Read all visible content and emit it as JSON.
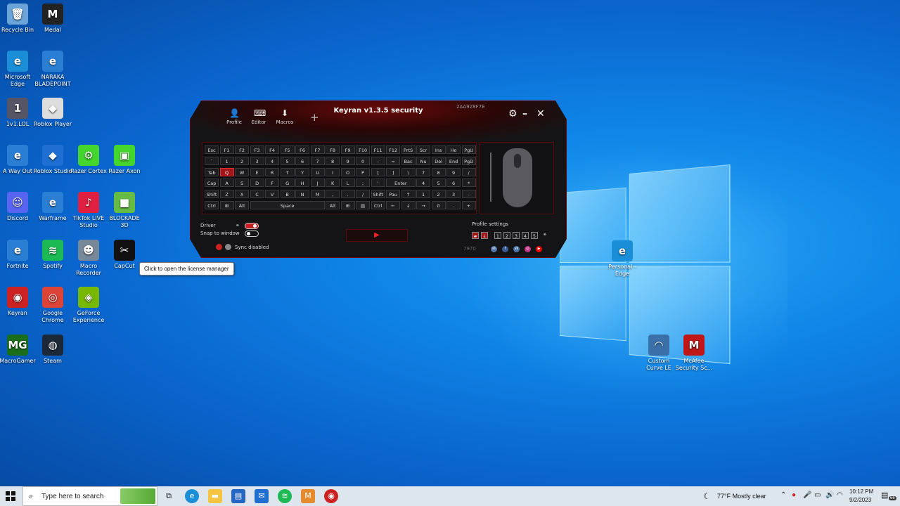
{
  "desktop": {
    "icons": [
      {
        "label": "Recycle Bin",
        "glyph": "🗑",
        "color": "#6aa4d8"
      },
      {
        "label": "Medal",
        "glyph": "M",
        "color": "#222"
      },
      {
        "label": "Microsoft Edge",
        "glyph": "e",
        "color": "#1b8ed8"
      },
      {
        "label": "NARAKA BLADEPOINT",
        "glyph": "e",
        "color": "#2a7fd4"
      },
      {
        "label": "1v1.LOL",
        "glyph": "1",
        "color": "#556"
      },
      {
        "label": "Roblox Player",
        "glyph": "◆",
        "color": "#ddd"
      },
      {
        "label": "A Way Out",
        "glyph": "e",
        "color": "#2a7fd4"
      },
      {
        "label": "Roblox Studio",
        "glyph": "◆",
        "color": "#1e6fd1"
      },
      {
        "label": "Razer Cortex",
        "glyph": "⚙",
        "color": "#44d62c"
      },
      {
        "label": "Razer Axon",
        "glyph": "▣",
        "color": "#44d62c"
      },
      {
        "label": "Discord",
        "glyph": "☺",
        "color": "#5865f2"
      },
      {
        "label": "Warframe",
        "glyph": "e",
        "color": "#2a7fd4"
      },
      {
        "label": "TikTok LIVE Studio",
        "glyph": "♪",
        "color": "#e02040"
      },
      {
        "label": "BLOCKADE 3D",
        "glyph": "■",
        "color": "#6b4"
      },
      {
        "label": "Fortnite",
        "glyph": "e",
        "color": "#2a7fd4"
      },
      {
        "label": "Spotify",
        "glyph": "≋",
        "color": "#1db954"
      },
      {
        "label": "Macro Recorder",
        "glyph": "☻",
        "color": "#789"
      },
      {
        "label": "CapCut",
        "glyph": "✂",
        "color": "#111"
      },
      {
        "label": "Keyran",
        "glyph": "◉",
        "color": "#c22"
      },
      {
        "label": "Google Chrome",
        "glyph": "◎",
        "color": "#db4437"
      },
      {
        "label": "GeForce Experience",
        "glyph": "◈",
        "color": "#76b900"
      },
      {
        "label": "MacroGamer",
        "glyph": "MG",
        "color": "#1a6e1a"
      },
      {
        "label": "Steam",
        "glyph": "◍",
        "color": "#1b2838"
      },
      {
        "label": "Personal - Edge",
        "glyph": "e",
        "color": "#1b8ed8"
      },
      {
        "label": "Custom Curve LE",
        "glyph": "◠",
        "color": "#3a6fa8"
      },
      {
        "label": "McAfee Security Sc...",
        "glyph": "M",
        "color": "#c01818"
      }
    ],
    "tooltip": "Click to open the license manager"
  },
  "keyran": {
    "title": "Keyran v1.3.5 security",
    "id_code": "2AA928F7E",
    "toolbar": [
      {
        "label": "Profile",
        "icon": "user-icon"
      },
      {
        "label": "Editor",
        "icon": "keyboard-icon"
      },
      {
        "label": "Macros",
        "icon": "download-icon"
      }
    ],
    "keyboard_rows": [
      [
        "Esc",
        "F1",
        "F2",
        "F3",
        "F4",
        "F5",
        "F6",
        "F7",
        "F8",
        "F9",
        "F10",
        "F11",
        "F12",
        "PrtS",
        "Scr",
        "Ins",
        "Ho",
        "PgU"
      ],
      [
        "`",
        "1",
        "2",
        "3",
        "4",
        "5",
        "6",
        "7",
        "8",
        "9",
        "0",
        "-",
        "=",
        "Bac",
        "Nu",
        "Del",
        "End",
        "PgD"
      ],
      [
        "Tab",
        "Q",
        "W",
        "E",
        "R",
        "T",
        "Y",
        "U",
        "I",
        "O",
        "P",
        "[",
        "]",
        "\\",
        "7",
        "8",
        "9",
        "/"
      ],
      [
        "Cap",
        "A",
        "S",
        "D",
        "F",
        "G",
        "H",
        "J",
        "K",
        "L",
        ";",
        "'",
        "Enter",
        "4",
        "5",
        "6",
        "*"
      ],
      [
        "Shift",
        "Z",
        "X",
        "C",
        "V",
        "B",
        "N",
        "M",
        ",",
        ".",
        "/",
        "Shift",
        "Pau",
        "↑",
        "1",
        "2",
        "3",
        "-"
      ],
      [
        "Ctrl",
        "⊞",
        "Alt",
        "Space",
        "Alt",
        "⊞",
        "▤",
        "Ctrl",
        "←",
        "↓",
        "→",
        "0",
        ".",
        "+"
      ]
    ],
    "highlighted_key": "Q",
    "driver_label": "Driver",
    "snap_label": "Snap to window",
    "sync_label": "Sync disabled",
    "profile_settings_label": "Profile settings",
    "profile_numbers": [
      "1",
      "2",
      "3",
      "4",
      "5"
    ],
    "counter": "7970"
  },
  "taskbar": {
    "search_placeholder": "Type here to search",
    "weather": "77°F  Mostly clear",
    "time": "10:12 PM",
    "date": "9/2/2023",
    "notif_count": "66"
  }
}
